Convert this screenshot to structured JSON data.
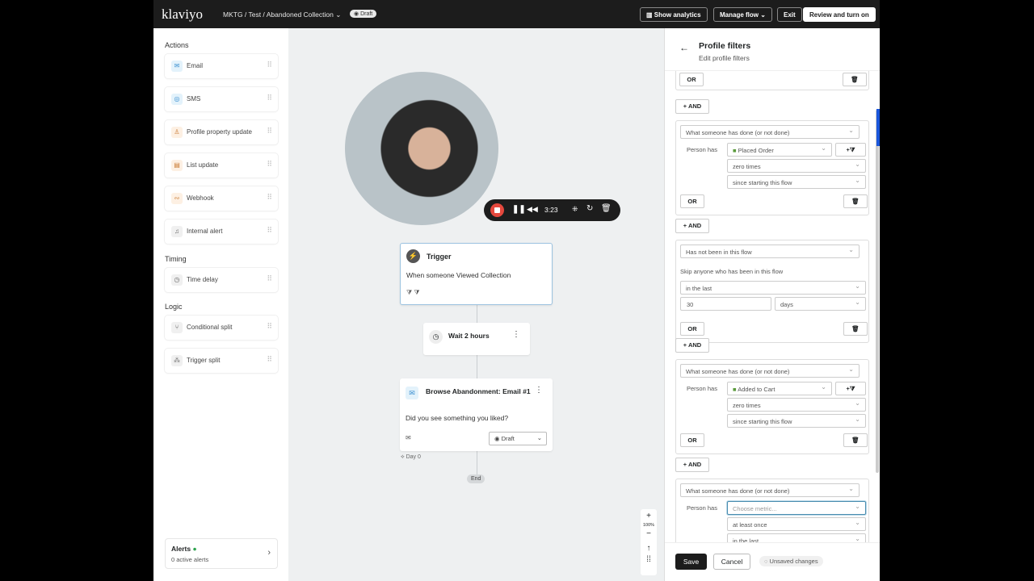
{
  "topbar": {
    "logo": "klaviyo",
    "breadcrumb": "MKTG / Test / Abandoned Collection",
    "status": "Draft",
    "show_analytics": "Show analytics",
    "manage_flow": "Manage flow",
    "exit": "Exit",
    "review": "Review and turn on"
  },
  "sidebar": {
    "actions_title": "Actions",
    "actions": [
      {
        "label": "Email",
        "icon": "mail-icon"
      },
      {
        "label": "SMS",
        "icon": "sms-icon"
      },
      {
        "label": "Profile property update",
        "icon": "person-icon"
      },
      {
        "label": "List update",
        "icon": "list-icon"
      },
      {
        "label": "Webhook",
        "icon": "webhook-icon"
      },
      {
        "label": "Internal alert",
        "icon": "bell-icon"
      }
    ],
    "timing_title": "Timing",
    "timing": [
      {
        "label": "Time delay",
        "icon": "clock-icon"
      }
    ],
    "logic_title": "Logic",
    "logic": [
      {
        "label": "Conditional split",
        "icon": "split-icon"
      },
      {
        "label": "Trigger split",
        "icon": "trigger-split-icon"
      }
    ],
    "alerts_title": "Alerts",
    "alerts_sub": "0 active alerts"
  },
  "recorder": {
    "time": "3:23"
  },
  "flow": {
    "trigger_title": "Trigger",
    "trigger_desc": "When someone Viewed Collection",
    "wait": "Wait 2 hours",
    "email_title": "Browse Abandonment: Email #1",
    "email_desc": "Did you see something you liked?",
    "email_status": "Draft",
    "day": "Day 0",
    "end": "End"
  },
  "zoom": {
    "level": "100%"
  },
  "panel": {
    "title": "Profile filters",
    "subtitle": "Edit profile filters",
    "or": "OR",
    "and": "+ AND",
    "blocks": [
      {
        "type": "What someone has done (or not done)",
        "person_has": "Person has",
        "metric": "Placed Order",
        "freq": "zero times",
        "time": "since starting this flow"
      },
      {
        "type": "Has not been in this flow",
        "skip": "Skip anyone who has been in this flow",
        "range": "in the last",
        "value": "30",
        "unit": "days"
      },
      {
        "type": "What someone has done (or not done)",
        "person_has": "Person has",
        "metric": "Added to Cart",
        "freq": "zero times",
        "time": "since starting this flow"
      },
      {
        "type": "What someone has done (or not done)",
        "person_has": "Person has",
        "metric_placeholder": "Choose metric...",
        "freq": "at least once",
        "time": "in the last"
      }
    ],
    "save": "Save",
    "cancel": "Cancel",
    "unsaved": "Unsaved changes"
  }
}
